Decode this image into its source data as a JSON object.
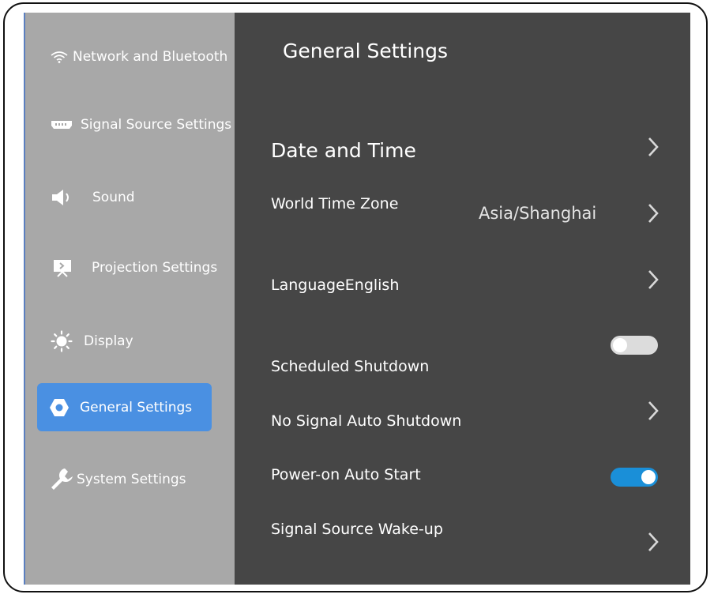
{
  "sidebar": {
    "items": [
      {
        "label": "Network and Bluetooth",
        "icon": "wifi-icon"
      },
      {
        "label": "Signal Source Settings",
        "icon": "hdmi-port-icon"
      },
      {
        "label": "Sound",
        "icon": "speaker-icon"
      },
      {
        "label": "Projection Settings",
        "icon": "projection-screen-icon"
      },
      {
        "label": "Display",
        "icon": "brightness-icon"
      },
      {
        "label": "General Settings",
        "icon": "hexagon-gear-icon",
        "selected": true
      },
      {
        "label": "System Settings",
        "icon": "wrench-icon"
      }
    ]
  },
  "main": {
    "title": "General Settings",
    "rows": [
      {
        "label": "Date and Time",
        "control": "chevron"
      },
      {
        "label": "World Time Zone",
        "value": "Asia/Shanghai",
        "control": "chevron"
      },
      {
        "label": "LanguageEnglish",
        "control": "chevron"
      },
      {
        "label": "Scheduled Shutdown",
        "control": "toggle",
        "on": false
      },
      {
        "label": "No Signal Auto Shutdown",
        "control": "chevron"
      },
      {
        "label": "Power-on Auto Start",
        "control": "toggle",
        "on": true
      },
      {
        "label": "Signal Source Wake-up",
        "control": "chevron"
      }
    ]
  },
  "colors": {
    "sidebar_bg": "#a8a8a8",
    "main_bg": "#464646",
    "accent": "#4a90e2",
    "toggle_on": "#1a8fd8",
    "toggle_off": "#dcdcdc"
  }
}
